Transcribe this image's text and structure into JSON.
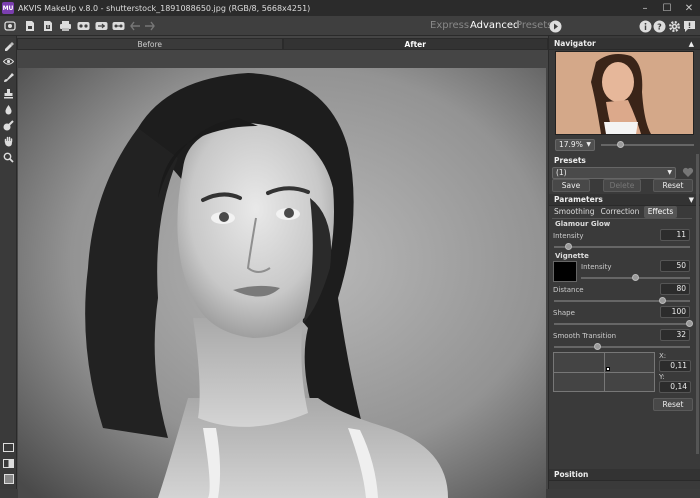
{
  "window": {
    "app_badge": "MU",
    "title": "AKVIS MakeUp v.8.0 - shutterstock_1891088650.jpg (RGB/8, 5668x4251)",
    "minimize": "–",
    "maximize": "☐",
    "close": "✕"
  },
  "toolbar": {
    "modes": [
      "Express",
      "Advanced",
      "Presets"
    ],
    "active_mode": "Advanced"
  },
  "canvas": {
    "tabs": [
      "Before",
      "After"
    ],
    "active_tab": "After"
  },
  "navigator": {
    "title": "Navigator",
    "zoom": "17.9%"
  },
  "presets": {
    "title": "Presets",
    "selected": "(1)",
    "save_label": "Save",
    "delete_label": "Delete",
    "reset_label": "Reset"
  },
  "parameters": {
    "title": "Parameters",
    "tabs": [
      "Smoothing",
      "Correction",
      "Effects"
    ],
    "active_tab": "Effects",
    "glamour_glow": {
      "title": "Glamour Glow",
      "intensity_label": "Intensity",
      "intensity": "11",
      "intensity_fraction": 0.11
    },
    "vignette": {
      "title": "Vignette",
      "color": "#000000",
      "intensity_label": "Intensity",
      "intensity": "50",
      "intensity_fraction": 0.5,
      "distance_label": "Distance",
      "distance": "80",
      "distance_fraction": 0.8,
      "shape_label": "Shape",
      "shape": "100",
      "shape_fraction": 1.0,
      "smooth_label": "Smooth Transition",
      "smooth": "32",
      "smooth_fraction": 0.32,
      "x_label": "X:",
      "x": "0,11",
      "y_label": "Y:",
      "y": "0,14",
      "reset_label": "Reset"
    }
  },
  "position": {
    "title": "Position"
  },
  "colors": {
    "accent": "#7b3fb0"
  }
}
